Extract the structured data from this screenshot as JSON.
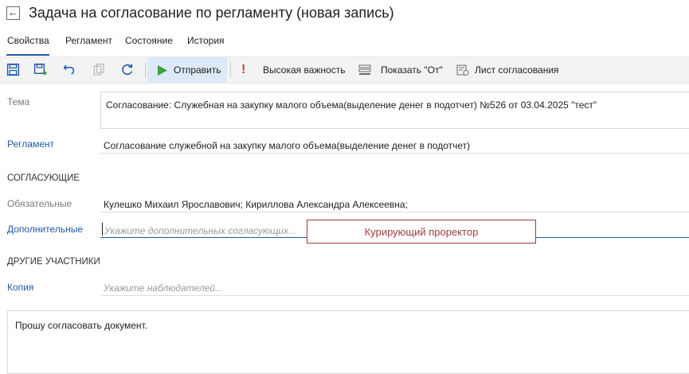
{
  "window": {
    "title": "Задача на согласование по регламенту (новая запись)"
  },
  "tabs": [
    {
      "label": "Свойства",
      "active": true
    },
    {
      "label": "Регламент"
    },
    {
      "label": "Состояние"
    },
    {
      "label": "История"
    }
  ],
  "toolbar": {
    "send_label": "Отправить",
    "importance_label": "Высокая важность",
    "show_from_label": "Показать \"От\"",
    "approval_sheet_label": "Лист согласования",
    "accent": "#1f5aa6",
    "send_icon_color": "#3aa335",
    "importance_icon_color": "#d13438"
  },
  "form": {
    "theme_label": "Тема",
    "theme_value": "Согласование: Служебная на закупку малого объема(выделение денег в подотчет) №526 от 03.04.2025 \"тест\"",
    "reglament_label": "Регламент",
    "reglament_value": "Согласование служебной на закупку малого объема(выделение денег в подотчет)",
    "approvers_section": "СОГЛАСУЮЩИЕ",
    "mandatory_label": "Обязательные",
    "mandatory_value": "Кулешко Михаил Ярославович;  Кириллова Александра Алексеевна;",
    "additional_label": "Дополнительные",
    "additional_placeholder": "Укажите дополнительных согласующих...",
    "other_section": "ДРУГИЕ УЧАСТНИКИ",
    "copy_label": "Копия",
    "copy_placeholder": "Укажите наблюдателей...",
    "note_text": "Прошу согласовать документ."
  },
  "popup": {
    "text": "Курирующий проректор",
    "color": "#a23a3a"
  }
}
